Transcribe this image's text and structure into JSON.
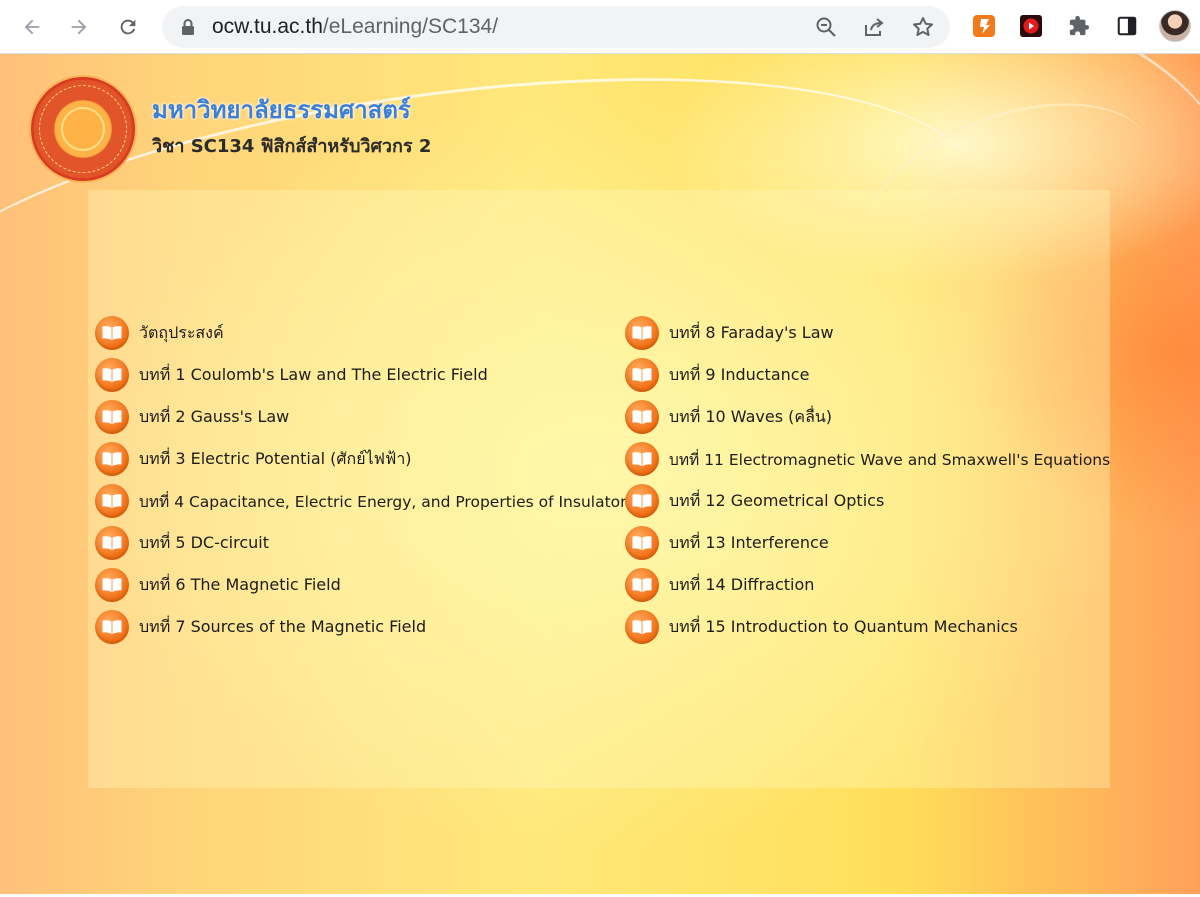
{
  "browser": {
    "url_host": "ocw.tu.ac.th",
    "url_path": "/eLearning/SC134/",
    "icons": [
      "back-arrow-icon",
      "forward-arrow-icon",
      "reload-icon",
      "lock-icon",
      "zoom-icon",
      "share-icon",
      "star-icon",
      "puzzle-icon",
      "side-panel-icon"
    ]
  },
  "header": {
    "university": "มหาวิทยาลัยธรรมศาสตร์",
    "course_title": "วิชา SC134  ฟิสิกส์สำหรับวิศวกร 2"
  },
  "lessons_left": [
    {
      "label": "วัตถุประสงค์"
    },
    {
      "label": "บทที่ 1 Coulomb's Law and The Electric Field"
    },
    {
      "label": "บทที่ 2 Gauss's Law"
    },
    {
      "label": "บทที่ 3 Electric Potential (ศักย์ไฟฟ้า)"
    },
    {
      "label": "บทที่ 4 Capacitance, Electric Energy, and Properties of Insulators"
    },
    {
      "label": "บทที่ 5 DC-circuit"
    },
    {
      "label": "บทที่ 6 The Magnetic Field"
    },
    {
      "label": "บทที่ 7 Sources of the Magnetic Field"
    }
  ],
  "lessons_right": [
    {
      "label": "บทที่ 8 Faraday's Law"
    },
    {
      "label": "บทที่ 9 Inductance"
    },
    {
      "label": "บทที่ 10 Waves (คลื่น)"
    },
    {
      "label": "บทที่ 11 Electromagnetic Wave and Smaxwell's Equations"
    },
    {
      "label": "บทที่ 12 Geometrical Optics"
    },
    {
      "label": "บทที่ 13 Interference"
    },
    {
      "label": "บทที่ 14 Diffraction"
    },
    {
      "label": "บทที่ 15 Introduction to Quantum Mechanics"
    }
  ],
  "colors": {
    "accent_blue": "#3d7fd6",
    "icon_orange": "#f06a10"
  }
}
